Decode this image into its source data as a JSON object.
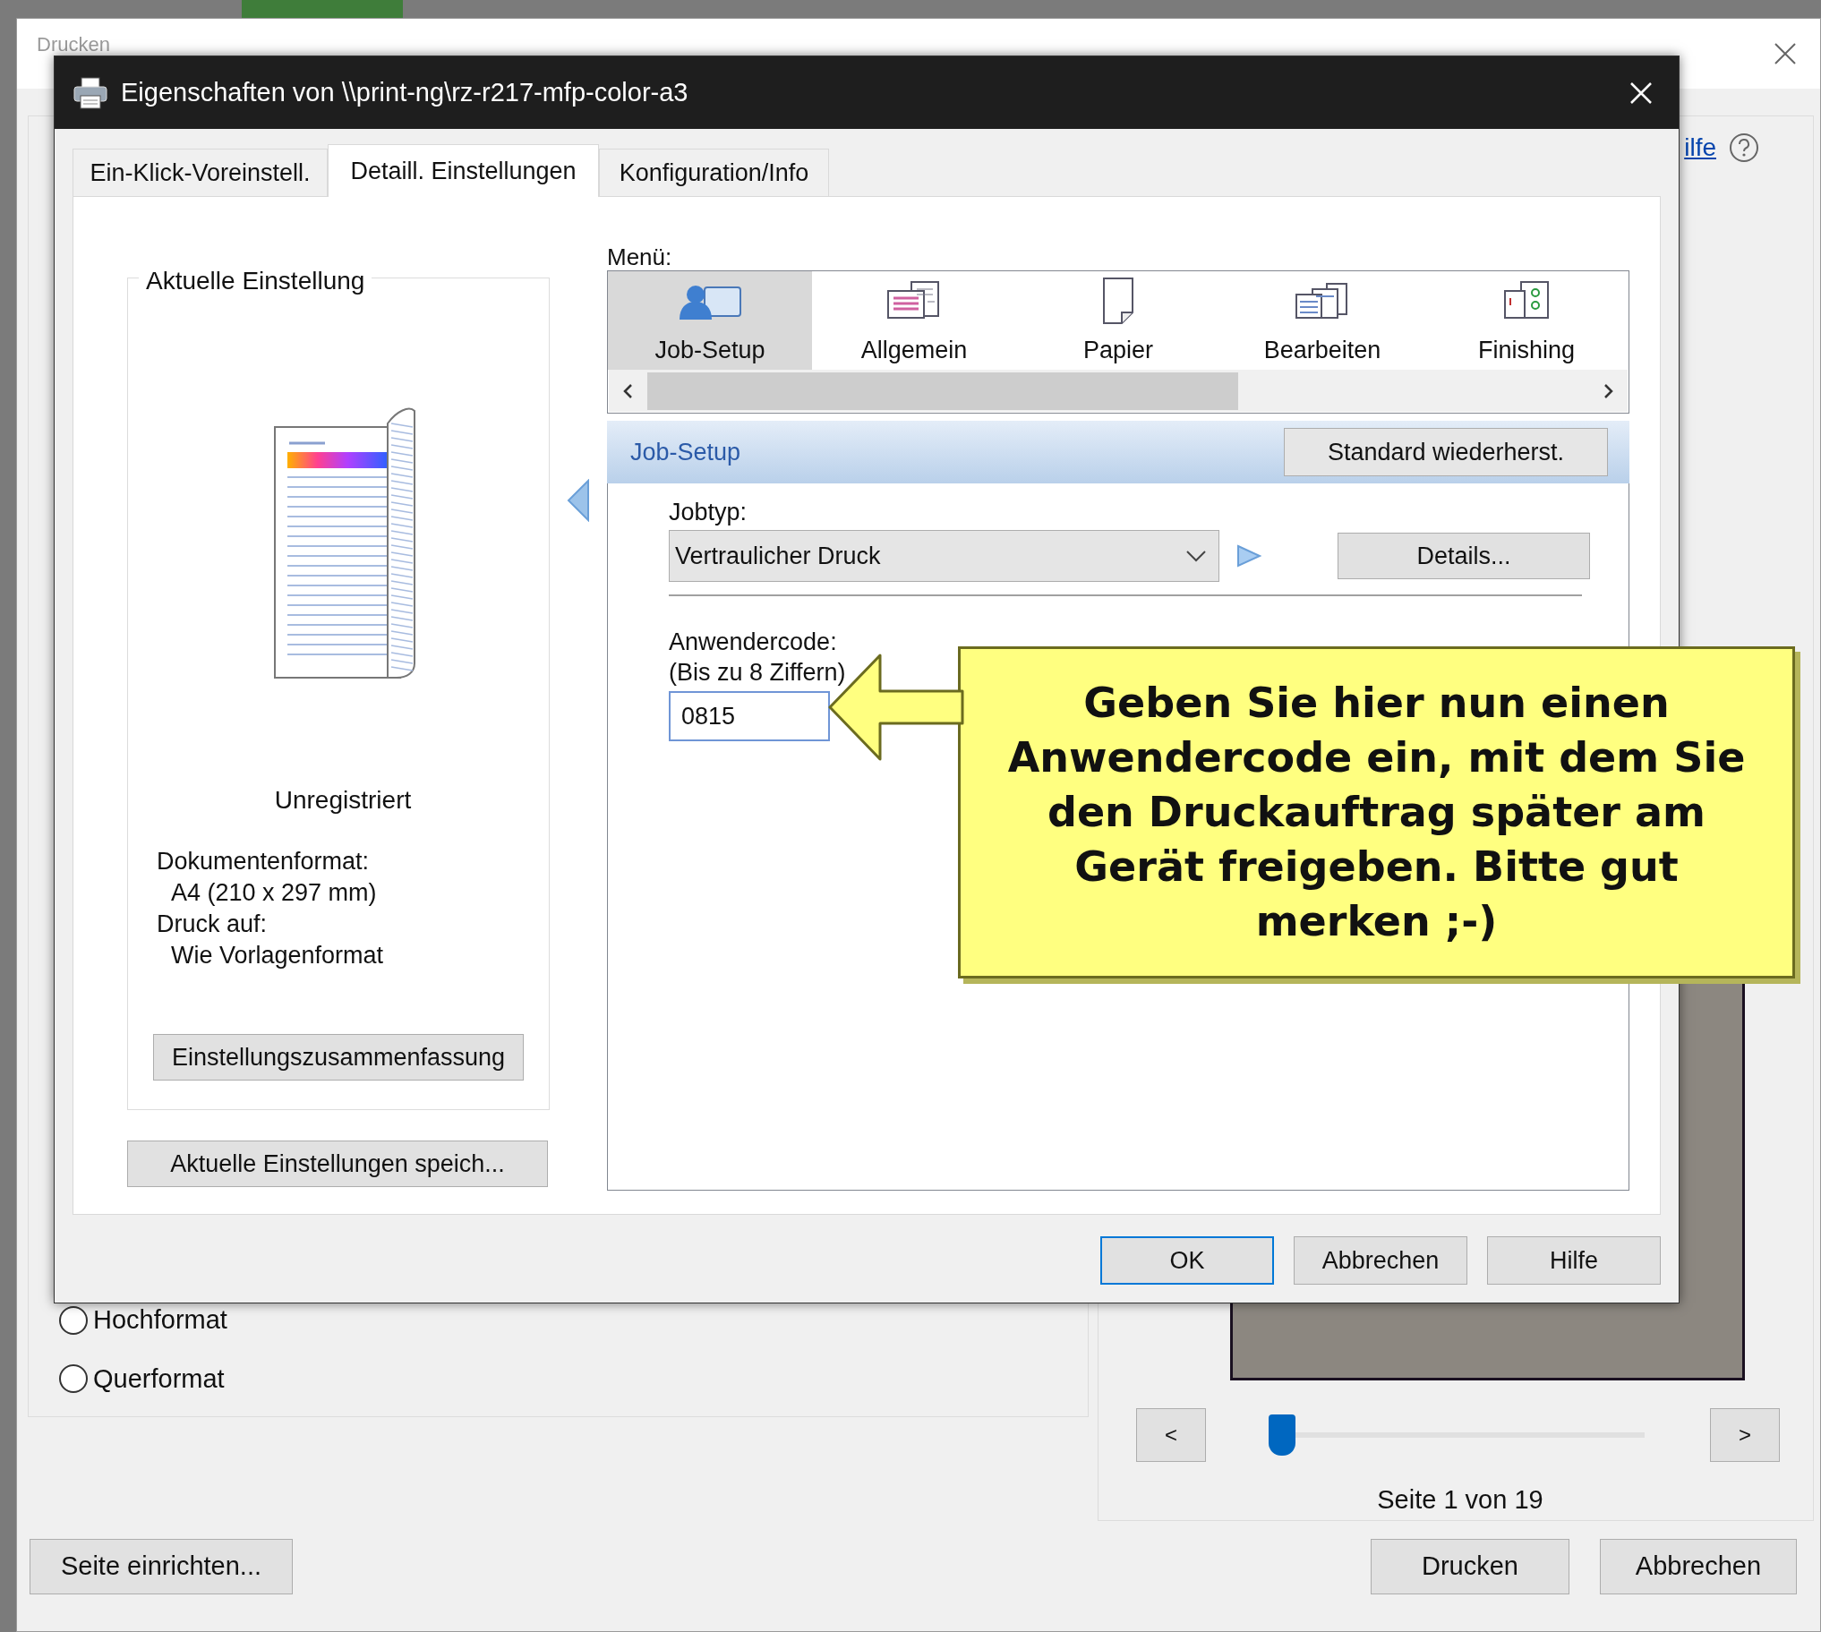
{
  "print_window": {
    "title": "Drucken",
    "help_link": "ilfe",
    "orientation_options": [
      {
        "label": "Hochformat",
        "selected": false
      },
      {
        "label": "Querformat",
        "selected": false
      }
    ],
    "preview": {
      "prev_button": "<",
      "next_button": ">",
      "page_slider": {
        "level": 0
      },
      "page_label": "Seite 1 von 19"
    },
    "page_setup_button": "Seite einrichten...",
    "print_button": "Drucken",
    "cancel_button": "Abbrechen"
  },
  "properties_dialog": {
    "title": "Eigenschaften von \\\\print-ng\\rz-r217-mfp-color-a3",
    "tabs": [
      {
        "label": "Ein-Klick-Voreinstell.",
        "selected": false
      },
      {
        "label": "Detaill. Einstellungen",
        "selected": true
      },
      {
        "label": "Konfiguration/Info",
        "selected": false
      }
    ],
    "current_settings": {
      "title": "Aktuelle Einstellung",
      "status": "Unregistriert",
      "lines": [
        {
          "kind": "label",
          "text": "Dokumentenformat:"
        },
        {
          "kind": "value",
          "text": "A4 (210 x 297 mm)"
        },
        {
          "kind": "label",
          "text": "Druck auf:"
        },
        {
          "kind": "value",
          "text": "Wie Vorlagenformat"
        }
      ],
      "summary_button": "Einstellungszusammenfassung"
    },
    "save_button": "Aktuelle Einstellungen speich...",
    "menu": {
      "label": "Menü:",
      "items": [
        {
          "label": "Job-Setup",
          "selected": true
        },
        {
          "label": "Allgemein",
          "selected": false
        },
        {
          "label": "Papier",
          "selected": false
        },
        {
          "label": "Bearbeiten",
          "selected": false
        },
        {
          "label": "Finishing",
          "selected": false
        }
      ]
    },
    "section": {
      "title": "Job-Setup",
      "reset_button": "Standard wiederherst."
    },
    "job_type": {
      "label": "Jobtyp:",
      "value": "Vertraulicher Druck"
    },
    "details_button": "Details...",
    "user_code": {
      "label": "Anwendercode:",
      "hint": "(Bis zu 8 Ziffern)",
      "value": "0815"
    },
    "buttons": [
      {
        "label": "OK",
        "default": true
      },
      {
        "label": "Abbrechen",
        "default": false
      },
      {
        "label": "Hilfe",
        "default": false
      }
    ]
  },
  "callout": {
    "text": "Geben Sie hier nun einen Anwendercode ein, mit dem Sie den Druckauftrag später am Gerät freigeben. Bitte gut merken ;-)"
  }
}
